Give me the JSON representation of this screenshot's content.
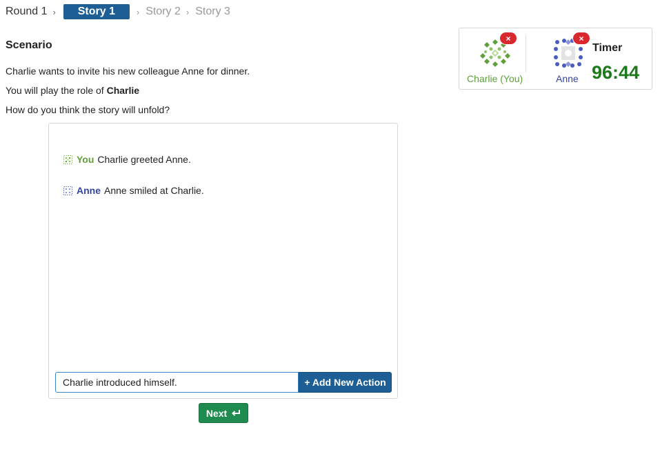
{
  "breadcrumb": {
    "round": "Round 1",
    "active": "Story 1",
    "story2": "Story 2",
    "story3": "Story 3",
    "sep": "›"
  },
  "scenario": {
    "title": "Scenario",
    "line1": "Charlie wants to invite his new colleague Anne for dinner.",
    "line2_prefix": "You will play the role of",
    "line2_role": "Charlie",
    "line3": "How do you think the story will unfold?"
  },
  "story": {
    "actions": [
      {
        "actor": "You",
        "text": "Charlie greeted Anne.",
        "actor_color": "#5fa03a",
        "icon": "green-pattern-icon"
      },
      {
        "actor": "Anne",
        "text": "Anne smiled at Charlie.",
        "actor_color": "#3646a0",
        "icon": "blue-pattern-icon"
      }
    ],
    "input_value": "Charlie introduced himself.",
    "add_button": "+ Add New Action"
  },
  "next_button": {
    "label": "Next",
    "icon": "enter-arrow-icon"
  },
  "players": [
    {
      "name": "Charlie (You)",
      "color": "#5fa03a",
      "badge": "×"
    },
    {
      "name": "Anne",
      "color": "#3646a0",
      "badge": "×"
    }
  ],
  "timer": {
    "label": "Timer",
    "value": "96:44",
    "color": "#1c7a1c"
  },
  "colors": {
    "primary": "#1d5f95",
    "next": "#1f8b4f",
    "danger": "#d9272e"
  }
}
